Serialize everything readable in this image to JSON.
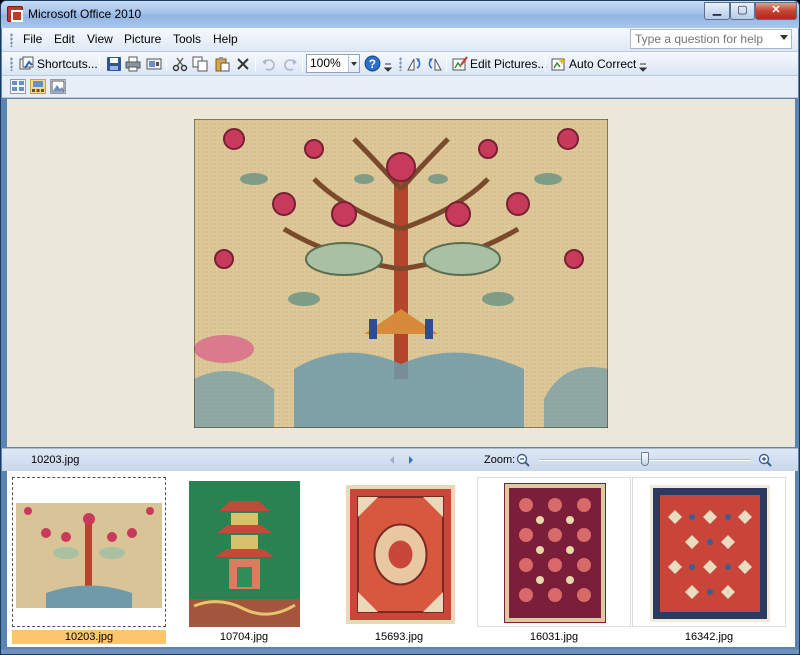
{
  "window": {
    "title": "Microsoft Office 2010"
  },
  "menu": {
    "items": [
      {
        "label": "File"
      },
      {
        "label": "Edit"
      },
      {
        "label": "View"
      },
      {
        "label": "Picture"
      },
      {
        "label": "Tools"
      },
      {
        "label": "Help"
      }
    ],
    "help_placeholder": "Type a question for help"
  },
  "toolbar": {
    "shortcuts_label": "Shortcuts...",
    "zoom_value": "100%",
    "edit_pictures_label": "Edit Pictures...",
    "auto_correct_label": "Auto Correct"
  },
  "status": {
    "current_file": "10203.jpg",
    "zoom_label": "Zoom:",
    "zoom_level": 0.5
  },
  "thumbnails": [
    {
      "filename": "10203.jpg",
      "selected": true,
      "icon": "rug-image-tree-of-life"
    },
    {
      "filename": "10704.jpg",
      "selected": false,
      "icon": "rug-image-pagoda"
    },
    {
      "filename": "15693.jpg",
      "selected": false,
      "icon": "rug-image-medallion"
    },
    {
      "filename": "16031.jpg",
      "selected": false,
      "icon": "rug-image-allover"
    },
    {
      "filename": "16342.jpg",
      "selected": false,
      "icon": "rug-image-herati"
    }
  ],
  "colors": {
    "titlebar": "#a3c2ea",
    "selection": "#fbc66f",
    "viewer_bg": "#ebe8da"
  }
}
